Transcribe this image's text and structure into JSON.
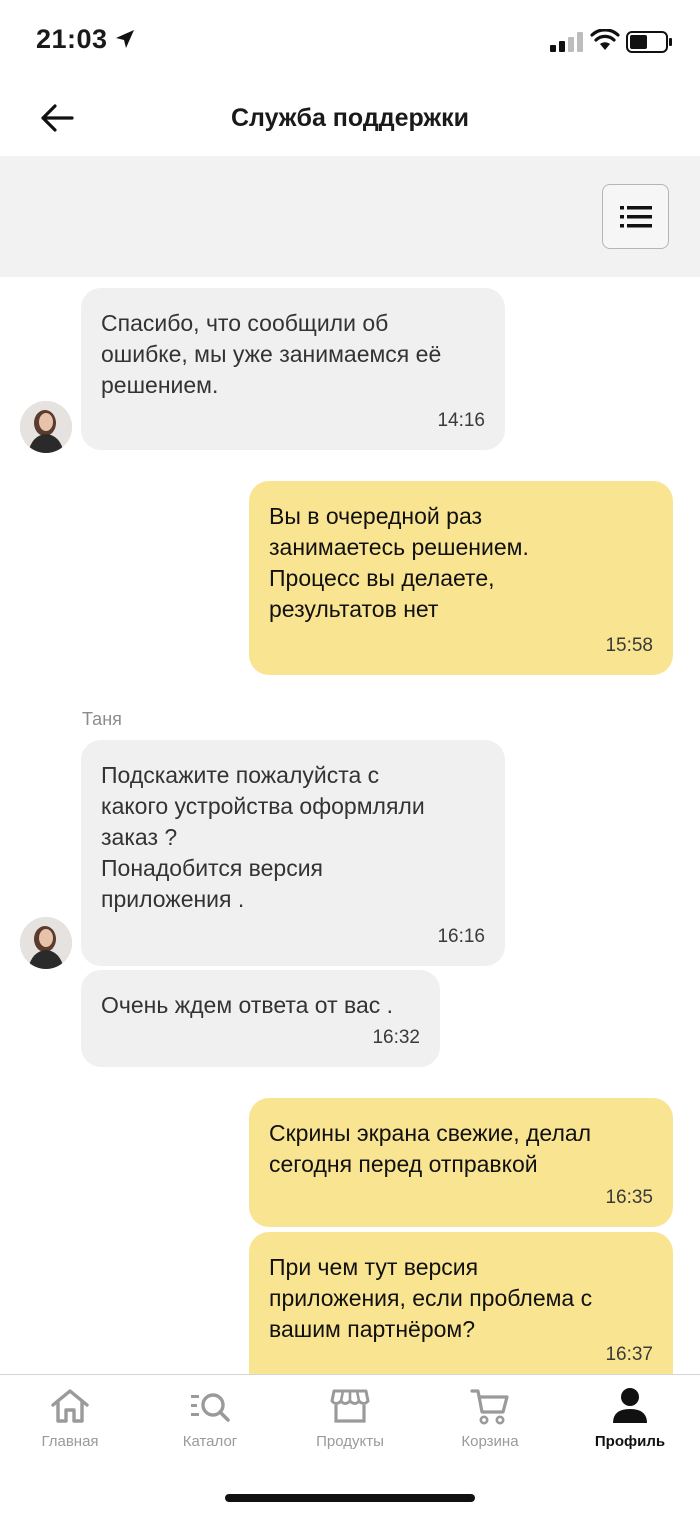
{
  "status_bar": {
    "time": "21:03"
  },
  "header": {
    "title": "Служба поддержки"
  },
  "messages": [
    {
      "text": "Спасибо, что сообщили об\nошибке, мы уже занимаемся её\nрешением.",
      "time": "14:16"
    },
    {
      "text": "Вы в очередной раз\nзанимаетесь решением.\nПроцесс вы делаете,\nрезультатов нет",
      "time": "15:58"
    },
    {
      "sender": "Таня",
      "text": "Подскажите пожалуйста с\nкакого устройства оформляли\nзаказ ?\nПонадобится версия\nприложения .",
      "time": "16:16"
    },
    {
      "text": "Очень ждем ответа от вас .",
      "time": "16:32"
    },
    {
      "text": "Скрины экрана свежие, делал\nсегодня перед отправкой",
      "time": "16:35"
    },
    {
      "text": "При чем тут версия\nприложения, если проблема с\nвашим партнёром?",
      "time": "16:37"
    }
  ],
  "tabs": [
    {
      "label": "Главная",
      "icon": "home-icon"
    },
    {
      "label": "Каталог",
      "icon": "catalog-search-icon"
    },
    {
      "label": "Продукты",
      "icon": "store-icon"
    },
    {
      "label": "Корзина",
      "icon": "cart-icon"
    },
    {
      "label": "Профиль",
      "icon": "profile-icon",
      "active": true
    }
  ],
  "colors": {
    "outgoing_bubble": "#f9e591",
    "incoming_bubble": "#f0f0f0",
    "toolbar_bg": "#f2f2f2"
  }
}
